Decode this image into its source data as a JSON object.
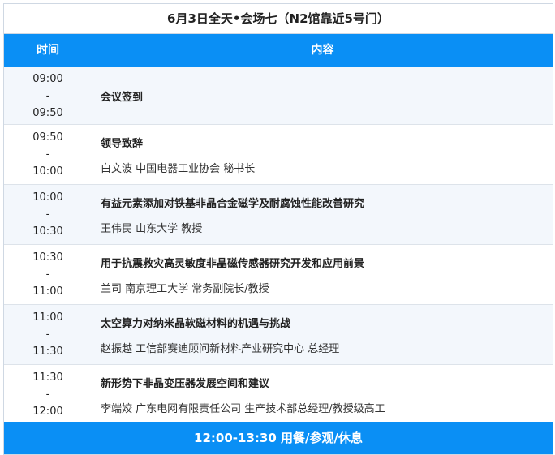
{
  "title": "6月3日全天•会场七（N2馆靠近5号门）",
  "header": {
    "time": "时间",
    "content": "内容"
  },
  "rows": [
    {
      "start": "09:00",
      "sep": "-",
      "end": "09:50",
      "topic": "会议签到",
      "speaker": ""
    },
    {
      "start": "09:50",
      "sep": "-",
      "end": "10:00",
      "topic": "领导致辞",
      "speaker": "白文波 中国电器工业协会 秘书长"
    },
    {
      "start": "10:00",
      "sep": "-",
      "end": "10:30",
      "topic": "有益元素添加对铁基非晶合金磁学及耐腐蚀性能改善研究",
      "speaker": "王伟民 山东大学 教授"
    },
    {
      "start": "10:30",
      "sep": "-",
      "end": "11:00",
      "topic": "用于抗震救灾高灵敏度非晶磁传感器研究开发和应用前景",
      "speaker": "兰司 南京理工大学 常务副院长/教授"
    },
    {
      "start": "11:00",
      "sep": "-",
      "end": "11:30",
      "topic": "太空算力对纳米晶软磁材料的机遇与挑战",
      "speaker": "赵振越 工信部赛迪顾问新材料产业研究中心 总经理"
    },
    {
      "start": "11:30",
      "sep": "-",
      "end": "12:00",
      "topic": "新形势下非晶变压器发展空间和建议",
      "speaker": "李端姣 广东电网有限责任公司 生产技术部总经理/教授级高工"
    }
  ],
  "footer": "12:00-13:30 用餐/参观/休息"
}
